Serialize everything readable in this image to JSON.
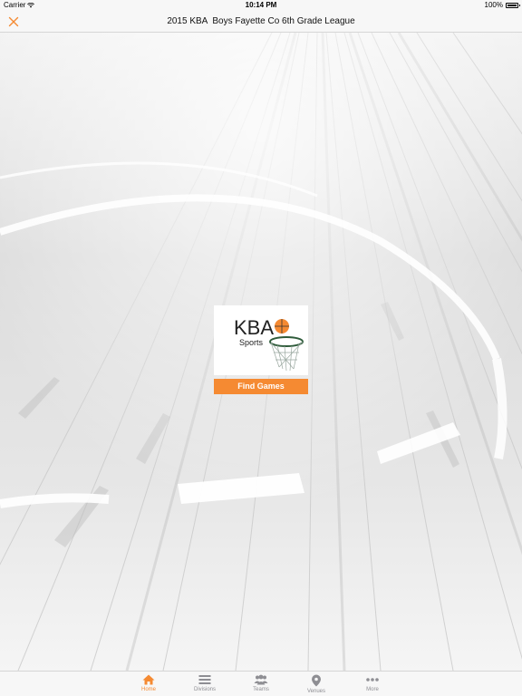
{
  "status_bar": {
    "carrier": "Carrier",
    "time": "10:14 PM",
    "battery": "100%"
  },
  "nav": {
    "title": "2015 KBA  Boys Fayette Co 6th Grade League",
    "close_icon": "close-icon"
  },
  "logo": {
    "letters": "KBA",
    "word": "Sports"
  },
  "main": {
    "find_games_label": "Find Games"
  },
  "tabs": [
    {
      "label": "Home",
      "icon": "home-icon",
      "active": true
    },
    {
      "label": "Divisions",
      "icon": "list-icon",
      "active": false
    },
    {
      "label": "Teams",
      "icon": "team-icon",
      "active": false
    },
    {
      "label": "Venues",
      "icon": "location-pin-icon",
      "active": false
    },
    {
      "label": "More",
      "icon": "more-icon",
      "active": false
    }
  ],
  "colors": {
    "accent": "#f58a32",
    "inactive": "#8e8e93",
    "bar_bg": "#f7f7f7"
  }
}
